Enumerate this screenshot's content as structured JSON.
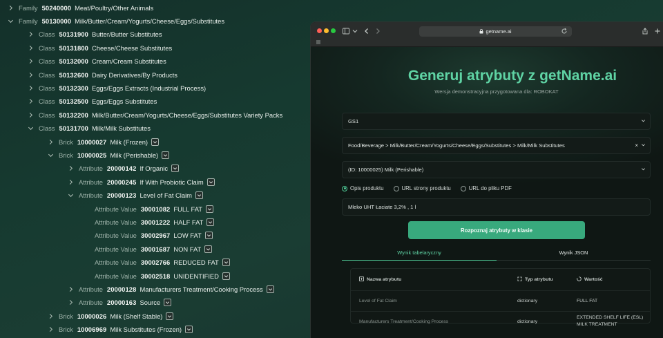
{
  "tree": [
    {
      "level": "Family",
      "code": "50240000",
      "title": "Meat/Poultry/Other Animals",
      "expanded": false,
      "dropdown": false
    },
    {
      "level": "Family",
      "code": "50130000",
      "title": "Milk/Butter/Cream/Yogurts/Cheese/Eggs/Substitutes",
      "expanded": true,
      "dropdown": false
    },
    {
      "level": "Class",
      "code": "50131900",
      "title": "Butter/Butter Substitutes",
      "expanded": false,
      "dropdown": false
    },
    {
      "level": "Class",
      "code": "50131800",
      "title": "Cheese/Cheese Substitutes",
      "expanded": false,
      "dropdown": false
    },
    {
      "level": "Class",
      "code": "50132000",
      "title": "Cream/Cream Substitutes",
      "expanded": false,
      "dropdown": false
    },
    {
      "level": "Class",
      "code": "50132600",
      "title": "Dairy Derivatives/By Products",
      "expanded": false,
      "dropdown": false
    },
    {
      "level": "Class",
      "code": "50132300",
      "title": "Eggs/Eggs Extracts (Industrial Process)",
      "expanded": false,
      "dropdown": false
    },
    {
      "level": "Class",
      "code": "50132500",
      "title": "Eggs/Eggs Substitutes",
      "expanded": false,
      "dropdown": false
    },
    {
      "level": "Class",
      "code": "50132200",
      "title": "Milk/Butter/Cream/Yogurts/Cheese/Eggs/Substitutes Variety Packs",
      "expanded": false,
      "dropdown": false
    },
    {
      "level": "Class",
      "code": "50131700",
      "title": "Milk/Milk Substitutes",
      "expanded": true,
      "dropdown": false
    },
    {
      "level": "Brick",
      "code": "10000027",
      "title": "Milk (Frozen)",
      "expanded": false,
      "dropdown": true
    },
    {
      "level": "Brick",
      "code": "10000025",
      "title": "Milk (Perishable)",
      "expanded": true,
      "dropdown": true
    },
    {
      "level": "Attribute",
      "code": "20000142",
      "title": "If Organic",
      "expanded": false,
      "dropdown": true
    },
    {
      "level": "Attribute",
      "code": "20000245",
      "title": "If With Probiotic Claim",
      "expanded": false,
      "dropdown": true
    },
    {
      "level": "Attribute",
      "code": "20000123",
      "title": "Level of Fat Claim",
      "expanded": true,
      "dropdown": true
    },
    {
      "level": "Attribute Value",
      "code": "30001082",
      "title": "FULL FAT",
      "expanded": null,
      "dropdown": true
    },
    {
      "level": "Attribute Value",
      "code": "30001222",
      "title": "HALF FAT",
      "expanded": null,
      "dropdown": true
    },
    {
      "level": "Attribute Value",
      "code": "30002967",
      "title": "LOW FAT",
      "expanded": null,
      "dropdown": true
    },
    {
      "level": "Attribute Value",
      "code": "30001687",
      "title": "NON FAT",
      "expanded": null,
      "dropdown": true
    },
    {
      "level": "Attribute Value",
      "code": "30002766",
      "title": "REDUCED FAT",
      "expanded": null,
      "dropdown": true
    },
    {
      "level": "Attribute Value",
      "code": "30002518",
      "title": "UNIDENTIFIED",
      "expanded": null,
      "dropdown": true
    },
    {
      "level": "Attribute",
      "code": "20000128",
      "title": "Manufacturers Treatment/Cooking Process",
      "expanded": false,
      "dropdown": true
    },
    {
      "level": "Attribute",
      "code": "20000163",
      "title": "Source",
      "expanded": false,
      "dropdown": true
    },
    {
      "level": "Brick",
      "code": "10000026",
      "title": "Milk (Shelf Stable)",
      "expanded": false,
      "dropdown": true
    },
    {
      "level": "Brick",
      "code": "10006969",
      "title": "Milk Substitutes (Frozen)",
      "expanded": false,
      "dropdown": true
    }
  ],
  "browser": {
    "url": "getname.ai",
    "hero_title": "Generuj atrybuty z getName.ai",
    "hero_subtitle": "Wersja demonstracyjna przygotowana dla: ROBOKAT",
    "standard_select": "GS1",
    "category_select": "Food/Beverage > Milk/Butter/Cream/Yogurts/Cheese/Eggs/Substitutes > Milk/Milk Substitutes",
    "brick_select": "(ID: 10000025) Milk (Perishable)",
    "radio_options": [
      "Opis produktu",
      "URL strony produktu",
      "URL do pliku PDF"
    ],
    "radio_selected": "Opis produktu",
    "product_input": "Mleko UHT Łaciate 3,2% , 1 l",
    "primary_button": "Rozpoznaj atrybuty w klasie",
    "tabs": {
      "table": "Wynik tabelaryczny",
      "json": "Wynik JSON"
    },
    "table_headers": {
      "name": "Nazwa atrybutu",
      "type": "Typ atrybutu",
      "value": "Wartość"
    },
    "rows": [
      {
        "name": "Level of Fat Claim",
        "type": "dictionary",
        "value": "FULL FAT",
        "value2": ""
      },
      {
        "name": "Manufacturers Treatment/Cooking Process",
        "type": "dictionary",
        "value": "EXTENDED SHELF LIFE (ESL)",
        "value2": "MILK TREATMENT"
      }
    ],
    "colors": {
      "accent": "#5fd3a4",
      "button": "#38a97d",
      "red": "#ff5f57",
      "yellow": "#febc2e",
      "green": "#28c840"
    }
  }
}
